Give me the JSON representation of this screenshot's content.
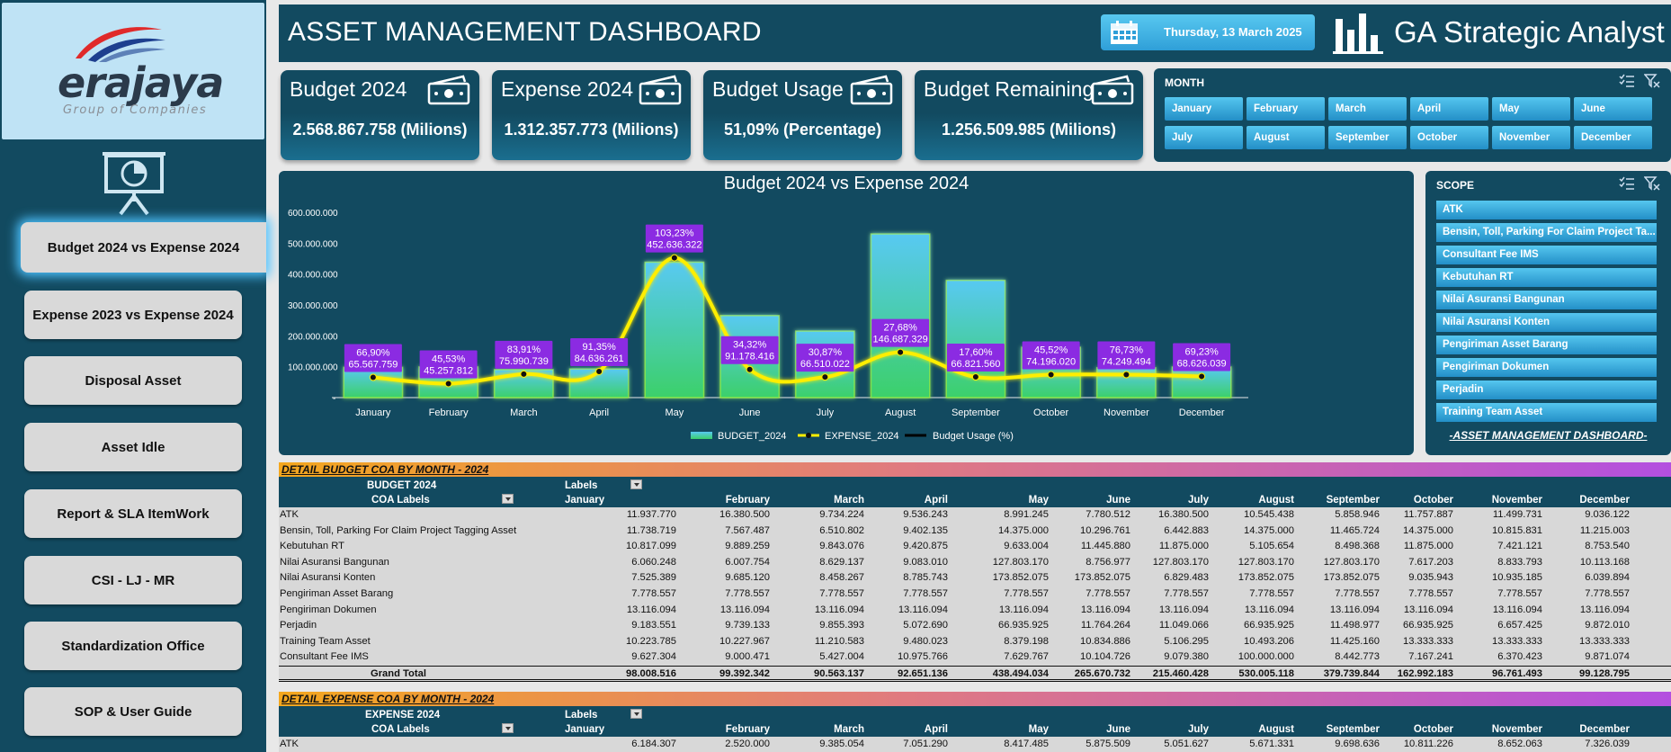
{
  "brand": {
    "logo_text": "erajaya",
    "logo_sub": "Group of Companies",
    "logo_colors": {
      "swoosh_red": "#e02a2a",
      "swoosh_blue": "#1d3f8f"
    }
  },
  "sidebar": {
    "items": [
      {
        "label": "Budget 2024 vs Expense 2024",
        "active": true
      },
      {
        "label": "Expense 2023 vs Expense 2024",
        "active": false
      },
      {
        "label": "Disposal Asset",
        "active": false
      },
      {
        "label": "Asset Idle",
        "active": false
      },
      {
        "label": "Report & SLA ItemWork",
        "active": false
      },
      {
        "label": "CSI - LJ - MR",
        "active": false
      },
      {
        "label": "Standardization Office",
        "active": false
      },
      {
        "label": "SOP & User Guide",
        "active": false
      }
    ]
  },
  "header": {
    "title": "ASSET MANAGEMENT DASHBOARD",
    "date": "Thursday, 13 March 2025",
    "brand_name": "GA Strategic Analyst"
  },
  "kpis": [
    {
      "title": "Budget 2024",
      "value": "2.568.867.758 (Milions)"
    },
    {
      "title": "Expense 2024",
      "value": "1.312.357.773 (Milions)"
    },
    {
      "title": "Budget Usage",
      "value": "51,09% (Percentage)"
    },
    {
      "title": "Budget Remaining",
      "value": "1.256.509.985 (Milions)"
    }
  ],
  "month_slicer": {
    "header": "MONTH",
    "items": [
      "January",
      "February",
      "March",
      "April",
      "May",
      "June",
      "July",
      "August",
      "September",
      "October",
      "November",
      "December"
    ]
  },
  "scope_slicer": {
    "header": "SCOPE",
    "items": [
      "ATK",
      "Bensin, Toll, Parking For Claim Project Ta...",
      "Consultant Fee IMS",
      "Kebutuhan RT",
      "Nilai Asuransi Bangunan",
      "Nilai Asuransi Konten",
      "Pengiriman Asset Barang",
      "Pengiriman Dokumen",
      "Perjadin",
      "Training Team Asset"
    ],
    "footer": "-ASSET MANAGEMENT DASHBOARD-"
  },
  "chart_data": {
    "type": "bar",
    "title": "Budget 2024 vs Expense 2024",
    "categories": [
      "January",
      "February",
      "March",
      "April",
      "May",
      "June",
      "July",
      "August",
      "September",
      "October",
      "November",
      "December"
    ],
    "series": [
      {
        "name": "BUDGET_2024",
        "type": "bar",
        "values": [
          98008516,
          99392342,
          90563137,
          92651136,
          438494034,
          265670732,
          215460428,
          530005118,
          379739844,
          162992183,
          96761493,
          99128795
        ]
      },
      {
        "name": "EXPENSE_2024",
        "type": "line",
        "values": [
          65567759,
          45257812,
          75990739,
          84636261,
          452636322,
          91178416,
          66510022,
          146687329,
          66821560,
          74196020,
          74249494,
          68626039
        ]
      },
      {
        "name": "Budget Usage (%)",
        "type": "label",
        "values": [
          "66,90%",
          "45,53%",
          "83,91%",
          "91,35%",
          "103,23%",
          "34,32%",
          "30,87%",
          "27,68%",
          "17,60%",
          "45,52%",
          "76,73%",
          "69,23%"
        ]
      }
    ],
    "data_labels": [
      "65.567.759",
      "45.257.812",
      "75.990.739",
      "84.636.261",
      "452.636.322",
      "91.178.416",
      "66.510.022",
      "146.687.329",
      "66.821.560",
      "74.196.020",
      "74.249.494",
      "68.626.039"
    ],
    "y_ticks": [
      "600.000.000",
      "500.000.000",
      "400.000.000",
      "300.000.000",
      "200.000.000",
      "100.000.000",
      "-"
    ],
    "ylim": [
      0,
      600000000
    ],
    "legend": "bottom",
    "grid": false,
    "colors": {
      "bar_top": "#4fc6ef",
      "bar_bottom": "#3bd46a",
      "line": "#ffee00",
      "label_bg": "#8b2be2"
    }
  },
  "budget_table": {
    "section_title": "DETAIL BUDGET COA BY MONTH - 2024",
    "value_header": "BUDGET 2024",
    "labels_header": "Labels",
    "row_header": "COA Labels",
    "months": [
      "January",
      "February",
      "March",
      "April",
      "May",
      "June",
      "July",
      "August",
      "September",
      "October",
      "November",
      "December"
    ],
    "rows": [
      {
        "label": "ATK",
        "values": [
          "11.937.770",
          "16.380.500",
          "9.734.224",
          "9.536.243",
          "8.991.245",
          "7.780.512",
          "16.380.500",
          "10.545.438",
          "5.858.946",
          "11.757.887",
          "11.499.731",
          "9.036.122"
        ]
      },
      {
        "label": "Bensin, Toll, Parking For Claim Project Tagging Asset",
        "values": [
          "11.738.719",
          "7.567.487",
          "6.510.802",
          "9.402.135",
          "14.375.000",
          "10.296.761",
          "6.442.883",
          "14.375.000",
          "11.465.724",
          "14.375.000",
          "10.815.831",
          "11.215.003"
        ]
      },
      {
        "label": "Kebutuhan RT",
        "values": [
          "10.817.099",
          "9.889.259",
          "9.843.076",
          "9.420.875",
          "9.633.004",
          "11.445.880",
          "11.875.000",
          "5.105.654",
          "8.498.368",
          "11.875.000",
          "7.421.121",
          "8.753.540"
        ]
      },
      {
        "label": "Nilai Asuransi Bangunan",
        "values": [
          "6.060.248",
          "6.007.754",
          "8.629.137",
          "9.083.010",
          "127.803.170",
          "8.756.977",
          "127.803.170",
          "127.803.170",
          "127.803.170",
          "7.617.203",
          "8.833.793",
          "10.113.168"
        ]
      },
      {
        "label": "Nilai Asuransi Konten",
        "values": [
          "7.525.389",
          "9.685.120",
          "8.458.267",
          "8.785.743",
          "173.852.075",
          "173.852.075",
          "6.829.483",
          "173.852.075",
          "173.852.075",
          "9.035.943",
          "10.935.185",
          "6.039.894"
        ]
      },
      {
        "label": "Pengiriman Asset Barang",
        "values": [
          "7.778.557",
          "7.778.557",
          "7.778.557",
          "7.778.557",
          "7.778.557",
          "7.778.557",
          "7.778.557",
          "7.778.557",
          "7.778.557",
          "7.778.557",
          "7.778.557",
          "7.778.557"
        ]
      },
      {
        "label": "Pengiriman Dokumen",
        "values": [
          "13.116.094",
          "13.116.094",
          "13.116.094",
          "13.116.094",
          "13.116.094",
          "13.116.094",
          "13.116.094",
          "13.116.094",
          "13.116.094",
          "13.116.094",
          "13.116.094",
          "13.116.094"
        ]
      },
      {
        "label": "Perjadin",
        "values": [
          "9.183.551",
          "9.739.133",
          "9.855.393",
          "5.072.690",
          "66.935.925",
          "11.764.264",
          "11.049.066",
          "66.935.925",
          "11.498.977",
          "66.935.925",
          "6.657.425",
          "9.872.010"
        ]
      },
      {
        "label": "Training Team Asset",
        "values": [
          "10.223.785",
          "10.227.967",
          "11.210.583",
          "9.480.023",
          "8.379.198",
          "10.834.886",
          "5.106.295",
          "10.493.206",
          "11.425.160",
          "13.333.333",
          "13.333.333",
          "13.333.333"
        ]
      },
      {
        "label": "Consultant Fee IMS",
        "values": [
          "9.627.304",
          "9.000.471",
          "5.427.004",
          "10.975.766",
          "7.629.767",
          "10.104.726",
          "9.079.380",
          "100.000.000",
          "8.442.773",
          "7.167.241",
          "6.370.423",
          "9.871.074"
        ]
      }
    ],
    "total": {
      "label": "Grand Total",
      "values": [
        "98.008.516",
        "99.392.342",
        "90.563.137",
        "92.651.136",
        "438.494.034",
        "265.670.732",
        "215.460.428",
        "530.005.118",
        "379.739.844",
        "162.992.183",
        "96.761.493",
        "99.128.795"
      ]
    }
  },
  "expense_table": {
    "section_title": "DETAIL EXPENSE COA BY MONTH - 2024",
    "value_header": "EXPENSE 2024",
    "labels_header": "Labels",
    "row_header": "COA Labels",
    "months": [
      "January",
      "February",
      "March",
      "April",
      "May",
      "June",
      "July",
      "August",
      "September",
      "October",
      "November",
      "December"
    ],
    "rows": [
      {
        "label": "ATK",
        "values": [
          "6.184.307",
          "2.520.000",
          "9.385.054",
          "7.051.290",
          "8.417.485",
          "5.875.509",
          "5.051.627",
          "5.671.331",
          "9.698.636",
          "10.811.226",
          "8.652.063",
          "7.326.039"
        ]
      }
    ]
  }
}
